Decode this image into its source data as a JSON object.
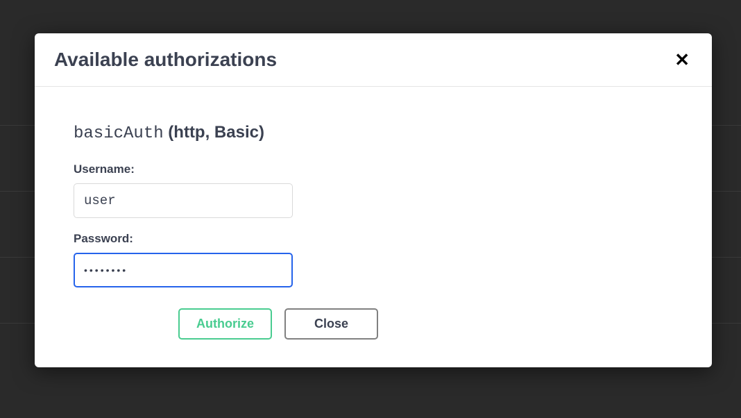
{
  "modal": {
    "title": "Available authorizations"
  },
  "auth": {
    "scheme_name": "basicAuth",
    "scheme_type": "(http, Basic)",
    "username_label": "Username:",
    "username_value": "user",
    "password_label": "Password:",
    "password_value": "••••••••"
  },
  "buttons": {
    "authorize": "Authorize",
    "close": "Close"
  }
}
